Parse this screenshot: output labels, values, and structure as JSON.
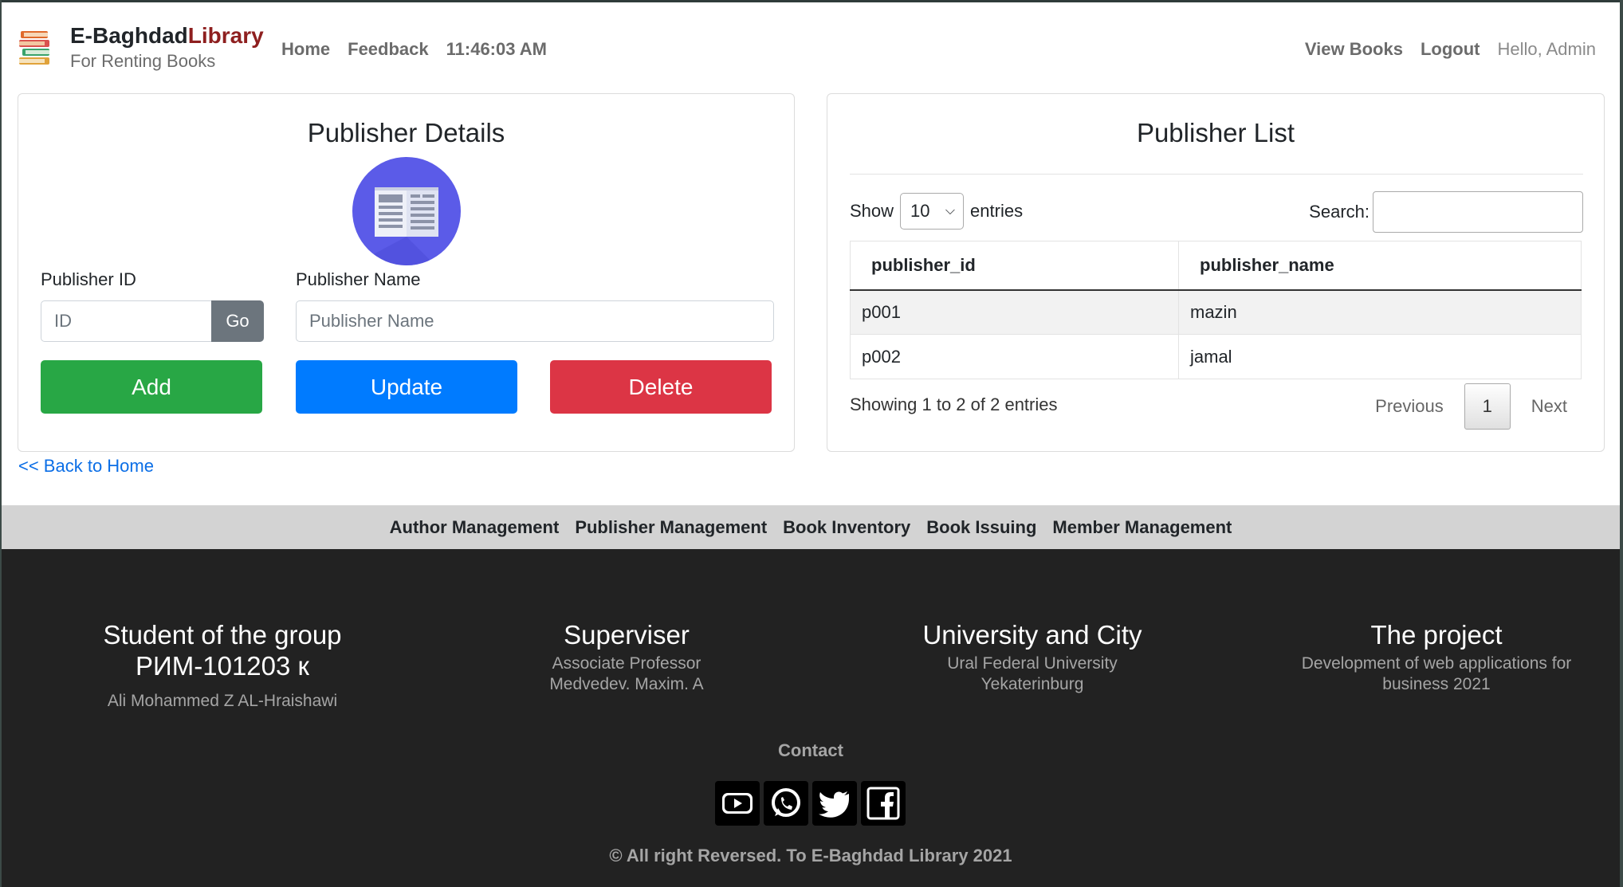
{
  "brand": {
    "name_part1": "E-Baghdad",
    "name_part2": "Library",
    "tagline": "For Renting Books",
    "logo_icon": "books-icon"
  },
  "nav": {
    "home": "Home",
    "feedback": "Feedback",
    "clock": "11:46:03 AM",
    "view_books": "View Books",
    "logout": "Logout",
    "greeting": "Hello, Admin"
  },
  "details": {
    "title": "Publisher Details",
    "icon": "newspaper-icon",
    "id_label": "Publisher ID",
    "id_placeholder": "ID",
    "go_label": "Go",
    "name_label": "Publisher Name",
    "name_placeholder": "Publisher Name",
    "add_label": "Add",
    "update_label": "Update",
    "delete_label": "Delete",
    "back_link": "<< Back to Home"
  },
  "list": {
    "title": "Publisher List",
    "show_label": "Show",
    "page_size": "10",
    "entries_label": "entries",
    "search_label": "Search:",
    "columns": [
      "publisher_id",
      "publisher_name"
    ],
    "rows": [
      [
        "p001",
        "mazin"
      ],
      [
        "p002",
        "jamal"
      ]
    ],
    "info": "Showing 1 to 2 of 2 entries",
    "prev": "Previous",
    "page": "1",
    "next": "Next"
  },
  "subnav": {
    "items": [
      "Author Management",
      "Publisher Management",
      "Book Inventory",
      "Book Issuing",
      "Member Management"
    ]
  },
  "footer": {
    "col1_title_line1": "Student of the group",
    "col1_title_line2": "РИМ-101203 к",
    "col1_text": "Ali Mohammed Z AL-Hraishawi",
    "col2_title": "Superviser",
    "col2_line1": "Associate Professor",
    "col2_line2": "Medvedev. Maxim. A",
    "col3_title": "University and City",
    "col3_line1": "Ural Federal University",
    "col3_line2": "Yekaterinburg",
    "col4_title": "The project",
    "col4_line1": "Development of web applications for",
    "col4_line2": "business 2021",
    "contact": "Contact",
    "socials": [
      "youtube-icon",
      "whatsapp-icon",
      "twitter-icon",
      "facebook-icon"
    ],
    "copyright": "© All right Reversed. To E-Baghdad Library 2021"
  },
  "colors": {
    "add": "#28a745",
    "update": "#007bff",
    "delete": "#dc3545",
    "brand_accent": "#8e1f1f",
    "footer_bg": "#222222"
  }
}
